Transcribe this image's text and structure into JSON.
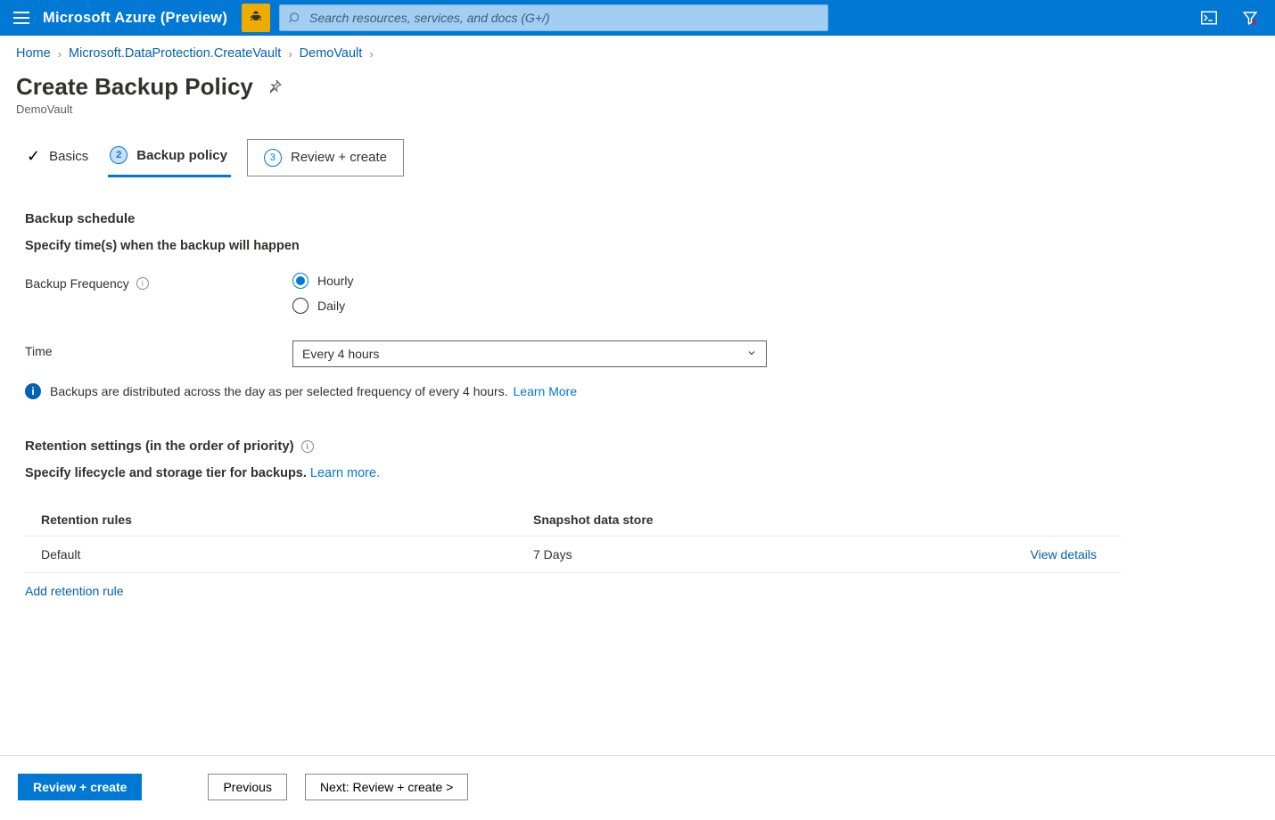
{
  "topbar": {
    "brand": "Microsoft Azure (Preview)",
    "search_placeholder": "Search resources, services, and docs (G+/)"
  },
  "breadcrumb": {
    "items": [
      "Home",
      "Microsoft.DataProtection.CreateVault",
      "DemoVault"
    ]
  },
  "page": {
    "title": "Create Backup Policy",
    "subtitle": "DemoVault"
  },
  "tabs": {
    "basics": "Basics",
    "backup_policy": "Backup policy",
    "review_create": "Review + create",
    "step2": "2",
    "step3": "3"
  },
  "schedule": {
    "heading": "Backup schedule",
    "subheading": "Specify time(s) when the backup will happen",
    "frequency_label": "Backup Frequency",
    "option_hourly": "Hourly",
    "option_daily": "Daily",
    "time_label": "Time",
    "time_value": "Every 4 hours",
    "info_text": "Backups are distributed across the day as per selected frequency of every 4 hours.",
    "info_link": "Learn More"
  },
  "retention": {
    "heading": "Retention settings (in the order of priority)",
    "subheading_text": "Specify lifecycle and storage tier for backups. ",
    "subheading_link": "Learn more.",
    "col_rules": "Retention rules",
    "col_store": "Snapshot data store",
    "rows": [
      {
        "name": "Default",
        "store": "7 Days",
        "action": "View details"
      }
    ],
    "add_link": "Add retention rule"
  },
  "footer": {
    "review_create": "Review + create",
    "previous": "Previous",
    "next": "Next: Review + create >"
  }
}
